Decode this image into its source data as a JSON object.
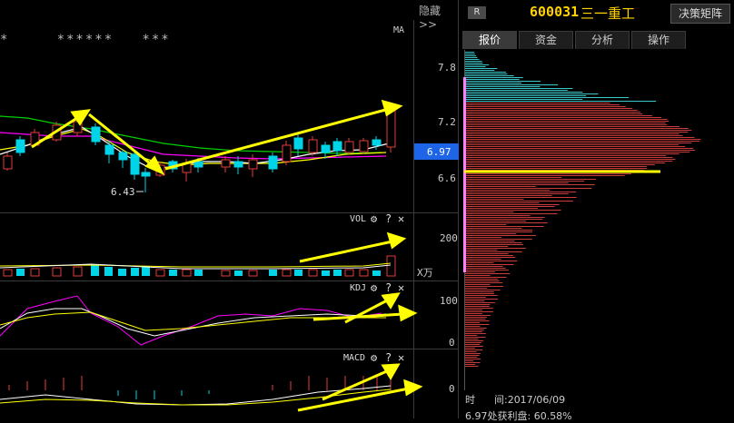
{
  "toolbar": {
    "hide_label": "隐藏>>"
  },
  "main_chart": {
    "stars": "*     ******   ***",
    "ma_label": "MA",
    "low_label": "6.43",
    "y_ticks": [
      "7.8",
      "7.2",
      "6.6"
    ],
    "current_price": "6.97",
    "current_price_color": "#1e64e6"
  },
  "vol_panel": {
    "name": "VOL",
    "y_tick": "200",
    "unit": "X万"
  },
  "kdj_panel": {
    "name": "KDJ",
    "y_ticks": [
      "100",
      "0"
    ]
  },
  "macd_panel": {
    "name": "MACD",
    "y_tick": "0"
  },
  "panel_controls": {
    "settings": "⚙",
    "help": "?",
    "close": "✕"
  },
  "right_panel": {
    "badge": "R",
    "code": "600031",
    "name": "三一重工",
    "decision_button": "决策矩阵",
    "tabs": [
      "报价",
      "资金",
      "分析",
      "操作"
    ],
    "active_tab": 0,
    "time_label": "时",
    "time_value": "间:2017/06/09",
    "profit_label": "6.97处获利盘: 60.58%"
  },
  "colors": {
    "up": "#e03c3c",
    "down": "#00d4e8",
    "ma5": "#ffffff",
    "ma10": "#ffff00",
    "ma20": "#ff00ff",
    "ma60": "#00d000",
    "arrow": "#ffff00",
    "chip_profit": "#c83c3c",
    "chip_loss": "#3cc8c8"
  }
}
